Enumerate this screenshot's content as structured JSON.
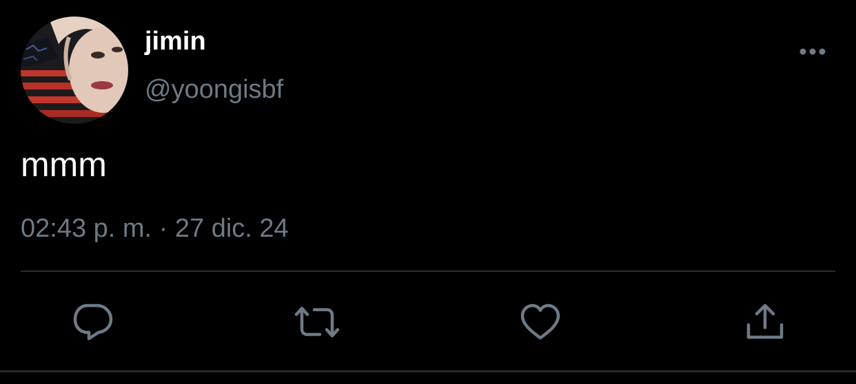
{
  "tweet": {
    "display_name": "jimin",
    "handle": "@yoongisbf",
    "text": "mmm",
    "timestamp": "02:43 p. m. · 27 dic. 24"
  },
  "icons": {
    "more": "more-horizontal-icon",
    "reply": "reply-bubble-icon",
    "retweet": "retweet-icon",
    "like": "heart-icon",
    "share": "share-upload-icon"
  },
  "colors": {
    "background": "#000000",
    "primary_text": "#ffffff",
    "secondary_text": "#6e7a85",
    "divider": "#2a2e33"
  }
}
